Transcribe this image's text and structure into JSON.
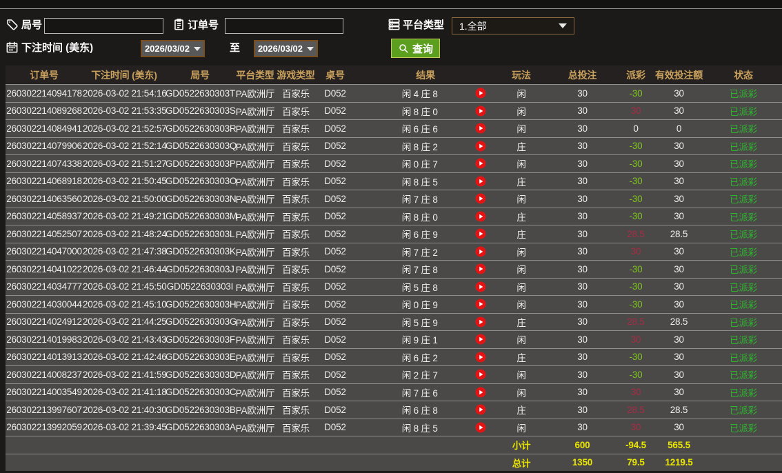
{
  "colors": {
    "page_bg": "#1c1a19",
    "row_bg": "#4b4948",
    "header_bg": "#242120",
    "header_text_gold": "#c9a05c",
    "payout_loss_green": "#7fc31f",
    "payout_win_red": "#a52c45",
    "status_green": "#2cb52c",
    "footer_yellow": "#e9e500",
    "search_button_green": "#5c9e1e",
    "date_border_brown": "#7a4e1c"
  },
  "icons": {
    "round_field": "tag-icon",
    "order_field": "clipboard-icon",
    "platform_field": "server-stack-icon",
    "bet_time_field": "calendar-icon",
    "search_button": "magnifier-icon",
    "dropdown": "caret-down-icon",
    "result_row": "play-circle-icon"
  },
  "filters": {
    "round_label": "局号",
    "round_value": "",
    "order_label": "订单号",
    "order_value": "",
    "platform_label": "平台类型",
    "platform_value": "1.全部",
    "bettime_label": "下注时间 (美东)",
    "date_from": "2026/03/02",
    "to_label": "至",
    "date_to": "2026/03/02",
    "search_label": "查询"
  },
  "table": {
    "headers": [
      "订单号",
      "下注时间 (美东)",
      "局号",
      "平台类型",
      "游戏类型",
      "桌号",
      "结果",
      "玩法",
      "总投注",
      "派彩",
      "有效投注额",
      "状态"
    ],
    "rows": [
      {
        "order": "260302214094178",
        "time": "2026-03-02 21:54:16",
        "round": "GD0522630303T",
        "platform": "PA欧洲厅",
        "game": "百家乐",
        "table_no": "D052",
        "result": "闲 4 庄 8",
        "play": "闲",
        "bet": "30",
        "payout": "-30",
        "payout_color": "green",
        "valid": "30",
        "status": "已派彩"
      },
      {
        "order": "260302214089268",
        "time": "2026-03-02 21:53:35",
        "round": "GD0522630303S",
        "platform": "PA欧洲厅",
        "game": "百家乐",
        "table_no": "D052",
        "result": "闲 8 庄 0",
        "play": "闲",
        "bet": "30",
        "payout": "30",
        "payout_color": "red",
        "valid": "30",
        "status": "已派彩"
      },
      {
        "order": "260302214084941",
        "time": "2026-03-02 21:52:57",
        "round": "GD0522630303R",
        "platform": "PA欧洲厅",
        "game": "百家乐",
        "table_no": "D052",
        "result": "闲 6 庄 6",
        "play": "闲",
        "bet": "30",
        "payout": "0",
        "payout_color": "white",
        "valid": "0",
        "status": "已派彩"
      },
      {
        "order": "260302214079906",
        "time": "2026-03-02 21:52:14",
        "round": "GD0522630303Q",
        "platform": "PA欧洲厅",
        "game": "百家乐",
        "table_no": "D052",
        "result": "闲 8 庄 2",
        "play": "庄",
        "bet": "30",
        "payout": "-30",
        "payout_color": "green",
        "valid": "30",
        "status": "已派彩"
      },
      {
        "order": "260302214074338",
        "time": "2026-03-02 21:51:27",
        "round": "GD0522630303P",
        "platform": "PA欧洲厅",
        "game": "百家乐",
        "table_no": "D052",
        "result": "闲 0 庄 7",
        "play": "闲",
        "bet": "30",
        "payout": "-30",
        "payout_color": "green",
        "valid": "30",
        "status": "已派彩"
      },
      {
        "order": "260302214068918",
        "time": "2026-03-02 21:50:45",
        "round": "GD0522630303O",
        "platform": "PA欧洲厅",
        "game": "百家乐",
        "table_no": "D052",
        "result": "闲 8 庄 5",
        "play": "庄",
        "bet": "30",
        "payout": "-30",
        "payout_color": "green",
        "valid": "30",
        "status": "已派彩"
      },
      {
        "order": "260302214063560",
        "time": "2026-03-02 21:50:00",
        "round": "GD0522630303N",
        "platform": "PA欧洲厅",
        "game": "百家乐",
        "table_no": "D052",
        "result": "闲 7 庄 8",
        "play": "闲",
        "bet": "30",
        "payout": "-30",
        "payout_color": "green",
        "valid": "30",
        "status": "已派彩"
      },
      {
        "order": "260302214058937",
        "time": "2026-03-02 21:49:21",
        "round": "GD0522630303M",
        "platform": "PA欧洲厅",
        "game": "百家乐",
        "table_no": "D052",
        "result": "闲 8 庄 0",
        "play": "庄",
        "bet": "30",
        "payout": "-30",
        "payout_color": "green",
        "valid": "30",
        "status": "已派彩"
      },
      {
        "order": "260302214052507",
        "time": "2026-03-02 21:48:24",
        "round": "GD0522630303L",
        "platform": "PA欧洲厅",
        "game": "百家乐",
        "table_no": "D052",
        "result": "闲 6 庄 9",
        "play": "庄",
        "bet": "30",
        "payout": "28.5",
        "payout_color": "red",
        "valid": "28.5",
        "status": "已派彩"
      },
      {
        "order": "260302214047000",
        "time": "2026-03-02 21:47:38",
        "round": "GD0522630303K",
        "platform": "PA欧洲厅",
        "game": "百家乐",
        "table_no": "D052",
        "result": "闲 7 庄 2",
        "play": "闲",
        "bet": "30",
        "payout": "30",
        "payout_color": "red",
        "valid": "30",
        "status": "已派彩"
      },
      {
        "order": "260302214041022",
        "time": "2026-03-02 21:46:44",
        "round": "GD0522630303J",
        "platform": "PA欧洲厅",
        "game": "百家乐",
        "table_no": "D052",
        "result": "闲 7 庄 8",
        "play": "闲",
        "bet": "30",
        "payout": "-30",
        "payout_color": "green",
        "valid": "30",
        "status": "已派彩"
      },
      {
        "order": "260302214034777",
        "time": "2026-03-02 21:45:50",
        "round": "GD0522630303I",
        "platform": "PA欧洲厅",
        "game": "百家乐",
        "table_no": "D052",
        "result": "闲 5 庄 8",
        "play": "闲",
        "bet": "30",
        "payout": "-30",
        "payout_color": "green",
        "valid": "30",
        "status": "已派彩"
      },
      {
        "order": "260302214030044",
        "time": "2026-03-02 21:45:10",
        "round": "GD0522630303H",
        "platform": "PA欧洲厅",
        "game": "百家乐",
        "table_no": "D052",
        "result": "闲 0 庄 9",
        "play": "闲",
        "bet": "30",
        "payout": "-30",
        "payout_color": "green",
        "valid": "30",
        "status": "已派彩"
      },
      {
        "order": "260302214024912",
        "time": "2026-03-02 21:44:25",
        "round": "GD0522630303G",
        "platform": "PA欧洲厅",
        "game": "百家乐",
        "table_no": "D052",
        "result": "闲 5 庄 9",
        "play": "庄",
        "bet": "30",
        "payout": "28.5",
        "payout_color": "red",
        "valid": "28.5",
        "status": "已派彩"
      },
      {
        "order": "260302214019983",
        "time": "2026-03-02 21:43:43",
        "round": "GD0522630303F",
        "platform": "PA欧洲厅",
        "game": "百家乐",
        "table_no": "D052",
        "result": "闲 9 庄 1",
        "play": "闲",
        "bet": "30",
        "payout": "30",
        "payout_color": "red",
        "valid": "30",
        "status": "已派彩"
      },
      {
        "order": "260302214013913",
        "time": "2026-03-02 21:42:46",
        "round": "GD0522630303E",
        "platform": "PA欧洲厅",
        "game": "百家乐",
        "table_no": "D052",
        "result": "闲 6 庄 2",
        "play": "庄",
        "bet": "30",
        "payout": "-30",
        "payout_color": "green",
        "valid": "30",
        "status": "已派彩"
      },
      {
        "order": "260302214008237",
        "time": "2026-03-02 21:41:59",
        "round": "GD0522630303D",
        "platform": "PA欧洲厅",
        "game": "百家乐",
        "table_no": "D052",
        "result": "闲 2 庄 7",
        "play": "闲",
        "bet": "30",
        "payout": "-30",
        "payout_color": "green",
        "valid": "30",
        "status": "已派彩"
      },
      {
        "order": "260302214003549",
        "time": "2026-03-02 21:41:18",
        "round": "GD0522630303C",
        "platform": "PA欧洲厅",
        "game": "百家乐",
        "table_no": "D052",
        "result": "闲 7 庄 6",
        "play": "闲",
        "bet": "30",
        "payout": "30",
        "payout_color": "red",
        "valid": "30",
        "status": "已派彩"
      },
      {
        "order": "260302213997607",
        "time": "2026-03-02 21:40:30",
        "round": "GD0522630303B",
        "platform": "PA欧洲厅",
        "game": "百家乐",
        "table_no": "D052",
        "result": "闲 6 庄 8",
        "play": "庄",
        "bet": "30",
        "payout": "28.5",
        "payout_color": "red",
        "valid": "28.5",
        "status": "已派彩"
      },
      {
        "order": "260302213992059",
        "time": "2026-03-02 21:39:45",
        "round": "GD0522630303A",
        "platform": "PA欧洲厅",
        "game": "百家乐",
        "table_no": "D052",
        "result": "闲 8 庄 5",
        "play": "闲",
        "bet": "30",
        "payout": "30",
        "payout_color": "red",
        "valid": "30",
        "status": "已派彩"
      }
    ],
    "subtotal": {
      "label": "小计",
      "bet": "600",
      "payout": "-94.5",
      "valid": "565.5"
    },
    "total": {
      "label": "总计",
      "bet": "1350",
      "payout": "79.5",
      "valid": "1219.5"
    }
  }
}
